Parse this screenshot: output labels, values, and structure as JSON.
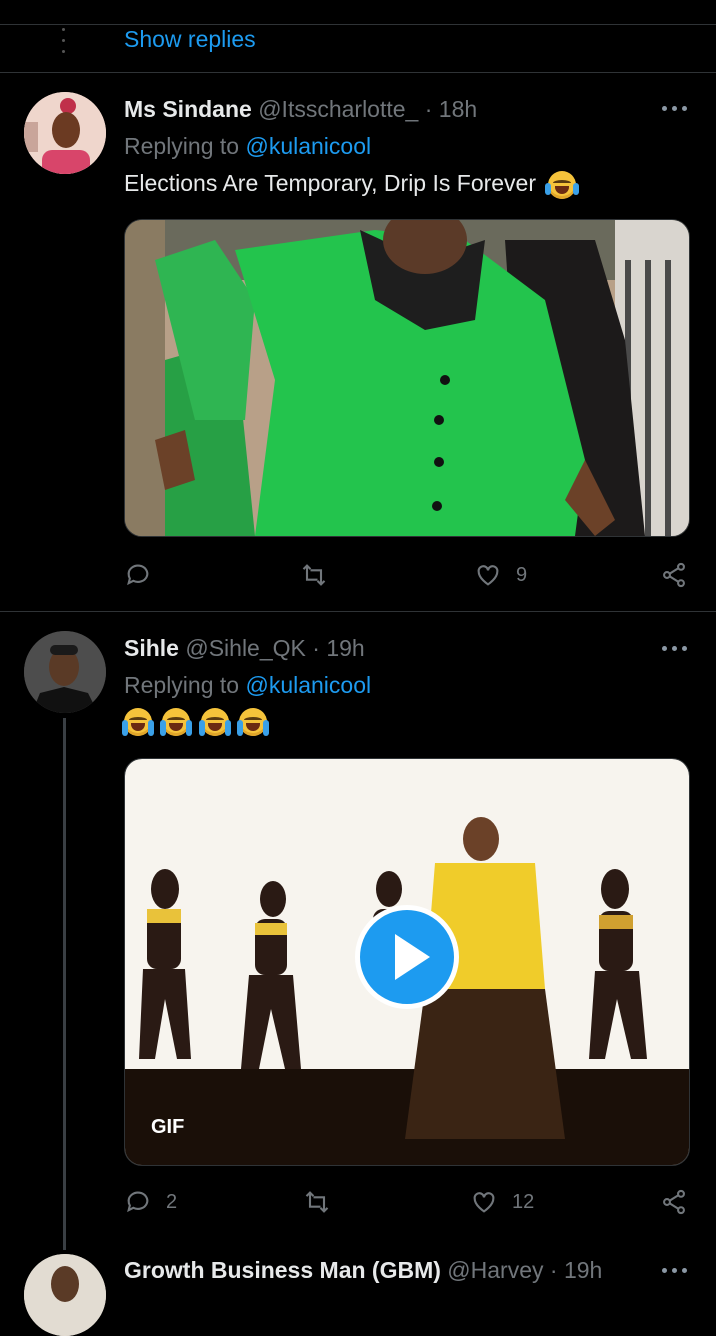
{
  "thread": {
    "show_replies": "Show replies"
  },
  "tweets": [
    {
      "display_name": "Ms Sindane",
      "handle": "@Itsscharlotte_",
      "time": "· 18h",
      "replying_prefix": "Replying to",
      "replying_to": "@kulanicool",
      "text": "Elections Are Temporary, Drip Is Forever",
      "emoji_icon": "face-with-tears-of-joy-icon",
      "actions": {
        "reply_count": "",
        "retweet_count": "",
        "like_count": "9"
      }
    },
    {
      "display_name": "Sihle",
      "handle": "@Sihle_QK",
      "time": "· 19h",
      "replying_prefix": "Replying to",
      "replying_to": "@kulanicool",
      "emoji_icons": [
        "loudly-crying-face-icon",
        "loudly-crying-face-icon",
        "loudly-crying-face-icon",
        "loudly-crying-face-icon"
      ],
      "media_badge": "GIF",
      "actions": {
        "reply_count": "2",
        "retweet_count": "",
        "like_count": "12"
      }
    },
    {
      "display_name": "Growth Business Man (GBM)",
      "handle": "@Harvey",
      "time": "· 19h"
    }
  ],
  "colors": {
    "background": "#000000",
    "accent": "#1d9bf0",
    "muted": "#71767b",
    "divider": "#2f3336"
  }
}
